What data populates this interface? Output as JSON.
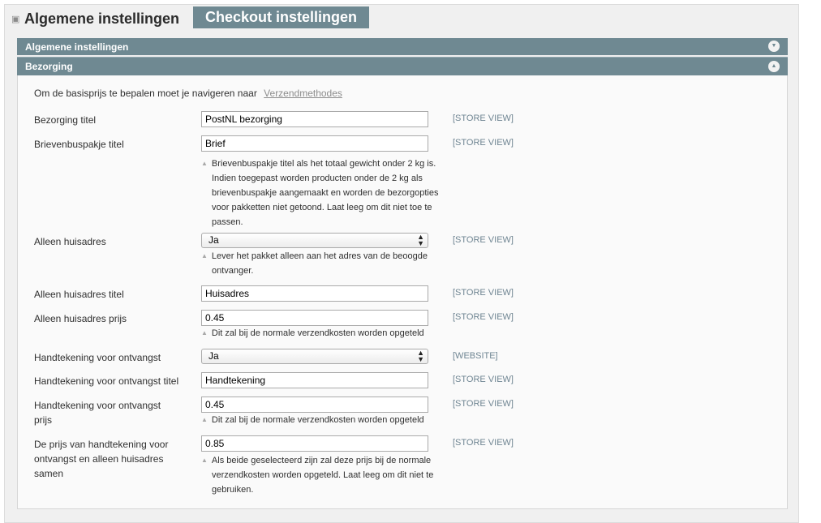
{
  "tabs": {
    "general_label": "Algemene instellingen",
    "checkout_label": "Checkout instellingen"
  },
  "sections": {
    "general_title": "Algemene instellingen",
    "delivery_title": "Bezorging"
  },
  "intro": {
    "text": "Om de basisprijs te bepalen moet je navigeren naar",
    "link": "Verzendmethodes"
  },
  "fields": [
    {
      "label": "Bezorging titel",
      "value": "PostNL bezorging",
      "scope": "[STORE VIEW]",
      "note": ""
    },
    {
      "label": "Brievenbuspakje titel",
      "value": "Brief",
      "scope": "[STORE VIEW]",
      "note": "Brievenbuspakje titel als het totaal gewicht onder 2 kg is. Indien toegepast worden producten onder de 2 kg als brievenbuspakje aangemaakt en worden de bezorgopties voor pakketten niet getoond. Laat leeg om dit niet toe te passen."
    },
    {
      "label": "Alleen huisadres",
      "value": "Ja",
      "scope": "[STORE VIEW]",
      "note": "Lever het pakket alleen aan het adres van de beoogde ontvanger."
    },
    {
      "label": "Alleen huisadres titel",
      "value": "Huisadres",
      "scope": "[STORE VIEW]",
      "note": ""
    },
    {
      "label": "Alleen huisadres prijs",
      "value": "0.45",
      "scope": "[STORE VIEW]",
      "note": "Dit zal bij de normale verzendkosten worden opgeteld"
    },
    {
      "label": "Handtekening voor ontvangst",
      "value": "Ja",
      "scope": "[WEBSITE]",
      "note": ""
    },
    {
      "label": "Handtekening voor ontvangst titel",
      "value": "Handtekening",
      "scope": "[STORE VIEW]",
      "note": ""
    },
    {
      "label": "Handtekening voor ontvangst prijs",
      "value": "0.45",
      "scope": "[STORE VIEW]",
      "note": "Dit zal bij de normale verzendkosten worden opgeteld"
    },
    {
      "label": "De prijs van handtekening voor ontvangst en alleen huisadres samen",
      "value": "0.85",
      "scope": "[STORE VIEW]",
      "note": "Als beide geselecteerd zijn zal deze prijs bij de normale verzendkosten worden opgeteld. Laat leeg om dit niet te gebruiken."
    }
  ],
  "colors": {
    "header_bg": "#6f8992",
    "scope_text": "#6f8592",
    "panel_bg": "#fafafa"
  },
  "icons": {
    "tab": "tab-pin-icon",
    "collapse": "chevron-down-circle-icon",
    "expand": "chevron-up-circle-icon",
    "note": "triangle-up-icon",
    "select": "select-arrows-icon"
  }
}
